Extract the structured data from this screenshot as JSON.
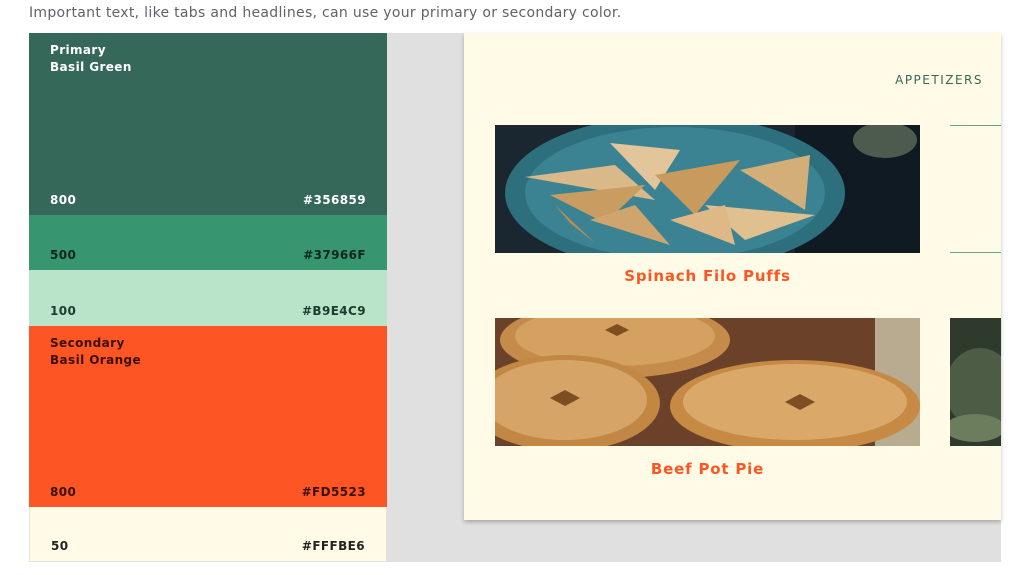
{
  "caption": "Important text, like tabs and headlines, can use your primary or secondary color.",
  "palette": {
    "primary": {
      "role": "Primary",
      "name": "Basil Green",
      "shades": [
        {
          "shade": "800",
          "hex": "#356859"
        },
        {
          "shade": "500",
          "hex": "#37966F"
        },
        {
          "shade": "100",
          "hex": "#B9E4C9"
        }
      ]
    },
    "secondary": {
      "role": "Secondary",
      "name": "Basil Orange",
      "shades": [
        {
          "shade": "800",
          "hex": "#FD5523"
        },
        {
          "shade": "50",
          "hex": "#FFFBE6"
        }
      ]
    }
  },
  "app": {
    "tab_label": "APPETIZERS",
    "dishes": [
      {
        "title": "Spinach Filo Puffs",
        "image": "filo-puffs-photo"
      },
      {
        "title": "Beef Pot Pie",
        "image": "pot-pie-photo"
      }
    ]
  }
}
